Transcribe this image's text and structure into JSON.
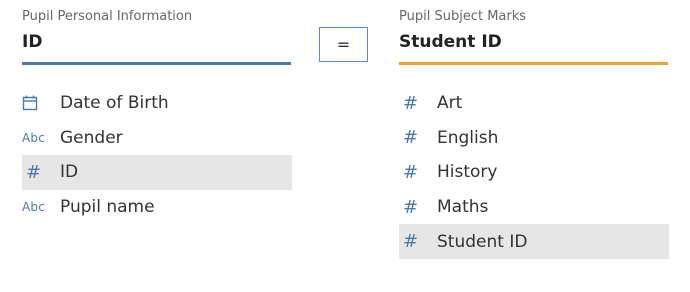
{
  "left_source": {
    "label": "Pupil Personal Information",
    "key_field": "ID",
    "accent_color": "#4e79a7",
    "fields": [
      {
        "type_icon": "calendar-icon",
        "name": "Date of Birth",
        "selected": false
      },
      {
        "type_icon": "abc-icon",
        "type_text": "Abc",
        "name": "Gender",
        "selected": false
      },
      {
        "type_icon": "hash-icon",
        "type_text": "#",
        "name": "ID",
        "selected": true
      },
      {
        "type_icon": "abc-icon",
        "type_text": "Abc",
        "name": "Pupil name",
        "selected": false
      }
    ]
  },
  "operator": {
    "label": "="
  },
  "right_source": {
    "label": "Pupil Subject Marks",
    "key_field": "Student ID",
    "accent_color": "#e8a33d",
    "fields": [
      {
        "type_icon": "hash-icon",
        "type_text": "#",
        "name": "Art",
        "selected": false
      },
      {
        "type_icon": "hash-icon",
        "type_text": "#",
        "name": "English",
        "selected": false
      },
      {
        "type_icon": "hash-icon",
        "type_text": "#",
        "name": "History",
        "selected": false
      },
      {
        "type_icon": "hash-icon",
        "type_text": "#",
        "name": "Maths",
        "selected": false
      },
      {
        "type_icon": "hash-icon",
        "type_text": "#",
        "name": "Student ID",
        "selected": true
      }
    ]
  }
}
